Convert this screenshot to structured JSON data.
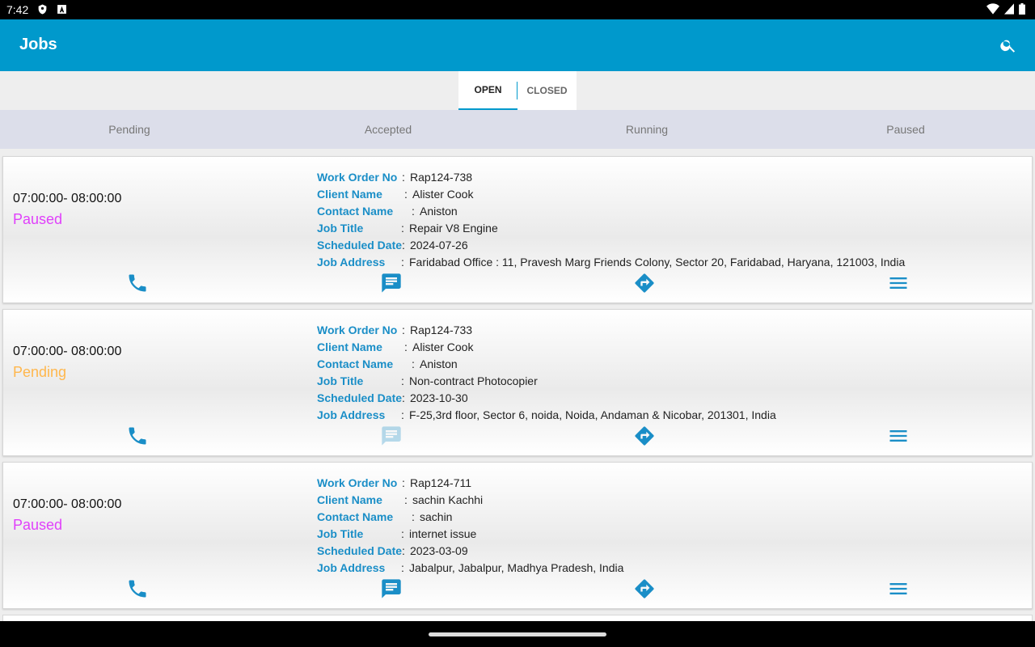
{
  "statusbar": {
    "time": "7:42"
  },
  "appbar": {
    "title": "Jobs"
  },
  "tabs": {
    "open": "OPEN",
    "closed": "CLOSED"
  },
  "filters": [
    "Pending",
    "Accepted",
    "Running",
    "Paused"
  ],
  "labels": {
    "work_order": "Work Order No",
    "client": "Client Name",
    "contact": "Contact Name",
    "job_title": "Job Title",
    "scheduled": "Scheduled Date",
    "address": "Job Address",
    "colon": ":"
  },
  "colors": {
    "accent": "#0099cc",
    "paused": "#e040fb",
    "pending": "#ffb74d"
  },
  "jobs": [
    {
      "time": "07:00:00- 08:00:00",
      "status": "Paused",
      "work_order": "Rap124-738",
      "client": "Alister Cook",
      "contact": "Aniston",
      "job_title": "Repair V8 Engine",
      "scheduled": "2024-07-26",
      "address": "Faridabad Office : 11, Pravesh Marg Friends Colony, Sector 20, Faridabad, Haryana, 121003, India",
      "message_enabled": true
    },
    {
      "time": "07:00:00- 08:00:00",
      "status": "Pending",
      "work_order": "Rap124-733",
      "client": "Alister Cook",
      "contact": "Aniston",
      "job_title": "Non-contract Photocopier",
      "scheduled": "2023-10-30",
      "address": "F-25,3rd floor, Sector 6, noida, Noida, Andaman & Nicobar, 201301, India",
      "message_enabled": false
    },
    {
      "time": "07:00:00- 08:00:00",
      "status": "Paused",
      "work_order": "Rap124-711",
      "client": "sachin Kachhi",
      "contact": "sachin",
      "job_title": "internet issue",
      "scheduled": "2023-03-09",
      "address": "Jabalpur, Jabalpur, Madhya Pradesh, India",
      "message_enabled": true
    }
  ]
}
